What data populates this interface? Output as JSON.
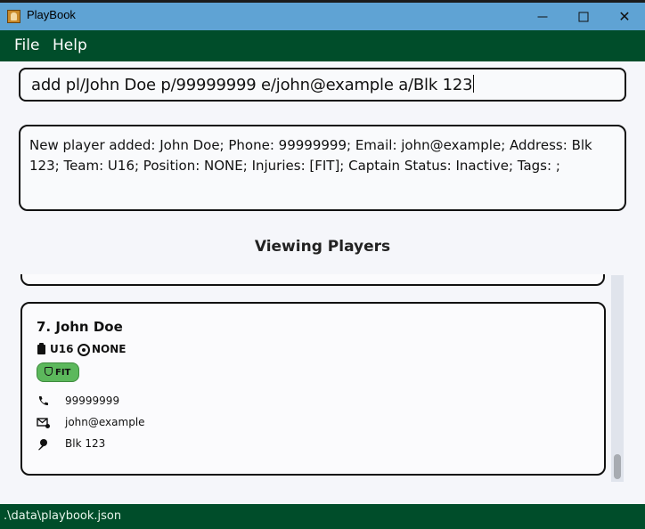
{
  "window": {
    "title": "PlayBook",
    "close_glyph": "✕"
  },
  "menu": {
    "file": "File",
    "help": "Help"
  },
  "command": {
    "value": "add pl/John Doe p/99999999 e/john@example a/Blk 123"
  },
  "result": {
    "text": "New player added: John Doe; Phone: 99999999; Email: john@example; Address: Blk 123; Team: U16; Position: NONE; Injuries: [FIT]; Captain Status: Inactive; Tags: ;"
  },
  "list": {
    "heading": "Viewing Players",
    "players": [
      {
        "name": "7.  John Doe",
        "team": "U16",
        "position": "NONE",
        "status": "FIT",
        "phone": "99999999",
        "email": "john@example",
        "address": "Blk 123"
      }
    ]
  },
  "status": {
    "path": ".\\data\\playbook.json"
  },
  "colors": {
    "title_bar": "#5fa3d4",
    "menu_bar": "#004d2a",
    "status_bar": "#004d2a",
    "fit_chip": "#5cb85c"
  }
}
